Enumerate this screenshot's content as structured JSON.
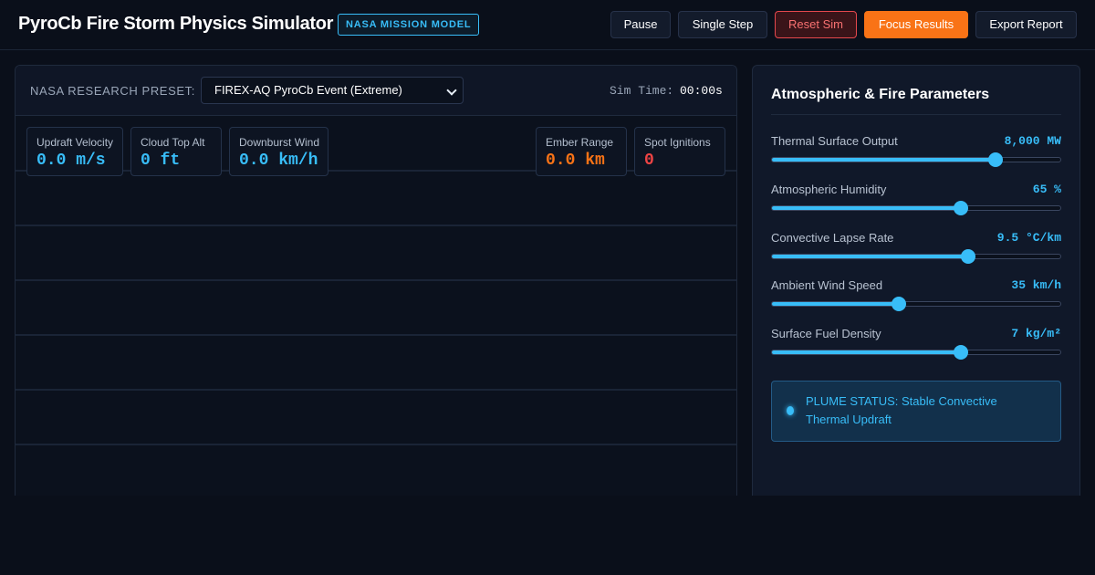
{
  "header": {
    "title": "PyroCb Fire Storm Physics Simulator",
    "badge": "NASA MISSION MODEL",
    "buttons": {
      "pause": "Pause",
      "single_step": "Single Step",
      "reset": "Reset Sim",
      "focus": "Focus Results",
      "export": "Export Report"
    }
  },
  "sim": {
    "preset_label": "NASA RESEARCH PRESET:",
    "preset_selected": "FIREX-AQ PyroCb Event (Extreme)",
    "time_label": "Sim Time:",
    "time_value": "00:00s"
  },
  "metrics": [
    {
      "label": "Updraft Velocity",
      "value": "0.0 m/s",
      "color": "#38bdf8"
    },
    {
      "label": "Cloud Top Alt",
      "value": "0 ft",
      "color": "#38bdf8"
    },
    {
      "label": "Downburst Wind",
      "value": "0.0 km/h",
      "color": "#38bdf8"
    },
    {
      "label": "Ember Range",
      "value": "0.0 km",
      "color": "#f97316"
    },
    {
      "label": "Spot Ignitions",
      "value": "0",
      "color": "#ef4444"
    }
  ],
  "params": {
    "title": "Atmospheric & Fire Parameters",
    "items": [
      {
        "label": "Thermal Surface Output",
        "value": "8,000 MW",
        "level": 0.775
      },
      {
        "label": "Atmospheric Humidity",
        "value": "65 %",
        "level": 0.655
      },
      {
        "label": "Convective Lapse Rate",
        "value": "9.5 °C/km",
        "level": 0.68
      },
      {
        "label": "Ambient Wind Speed",
        "value": "35 km/h",
        "level": 0.44
      },
      {
        "label": "Surface Fuel Density",
        "value": "7 kg/m²",
        "level": 0.655
      }
    ]
  },
  "status": {
    "text": "PLUME STATUS: Stable Convective Thermal Updraft"
  },
  "colors": {
    "accent": "#38bdf8",
    "warning": "#f97316",
    "danger": "#ef4444",
    "background": "#0a0f1a"
  }
}
